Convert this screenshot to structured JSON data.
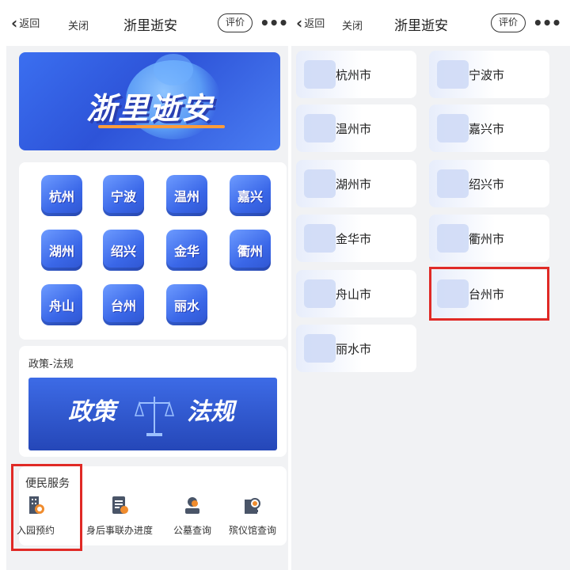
{
  "nav": {
    "back_label": "返回",
    "close_label": "关闭",
    "title": "浙里逝安",
    "rate_label": "评价",
    "more_label": "•••"
  },
  "banner": {
    "title": "浙里逝安"
  },
  "cities": [
    "杭州",
    "宁波",
    "温州",
    "嘉兴",
    "湖州",
    "绍兴",
    "金华",
    "衢州",
    "舟山",
    "台州",
    "丽水"
  ],
  "policy": {
    "label": "政策-法规",
    "banner_left": "政策",
    "banner_right": "法规"
  },
  "services": {
    "label": "便民服务",
    "items": [
      {
        "label": "入园预约",
        "icon": "building-icon"
      },
      {
        "label": "身后事联办进度",
        "icon": "document-icon"
      },
      {
        "label": "公墓查询",
        "icon": "person-search-icon"
      },
      {
        "label": "殡仪馆查询",
        "icon": "building-search-icon"
      }
    ]
  },
  "city_list": [
    "杭州市",
    "宁波市",
    "温州市",
    "嘉兴市",
    "湖州市",
    "绍兴市",
    "金华市",
    "衢州市",
    "舟山市",
    "台州市",
    "丽水市"
  ],
  "colors": {
    "accent": "#3a67e8",
    "highlight": "#e02a26"
  }
}
